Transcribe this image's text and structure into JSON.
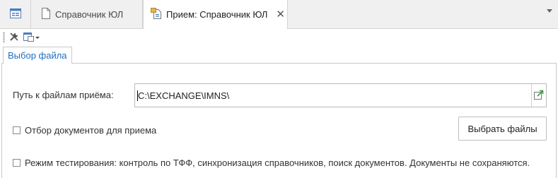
{
  "tabs": [
    {
      "label": "",
      "icon": "home-list-icon"
    },
    {
      "label": "Справочник ЮЛ",
      "icon": "document-icon"
    },
    {
      "label": "Прием: Справочник ЮЛ",
      "icon": "import-document-icon",
      "active": true
    }
  ],
  "toolbar": {
    "tools_icon": "tools-icon",
    "menu_icon": "form-menu-icon"
  },
  "inner_tab": {
    "label": "Выбор файла"
  },
  "form": {
    "path_label": "Путь к файлам приёма:",
    "path_value": "C:\\EXCHANGE\\IMNS\\",
    "select_doc_label": "Отбор документов для приема",
    "select_doc_checked": false,
    "select_files_button": "Выбрать файлы",
    "test_mode_label": "Режим тестирования: контроль по ТФФ, синхронизация справочников, поиск документов. Документы не сохраняются.",
    "test_mode_checked": false
  },
  "colors": {
    "accent": "#1f6fbf",
    "border": "#c8c8c8",
    "tabstrip": "#f0f0f0"
  }
}
